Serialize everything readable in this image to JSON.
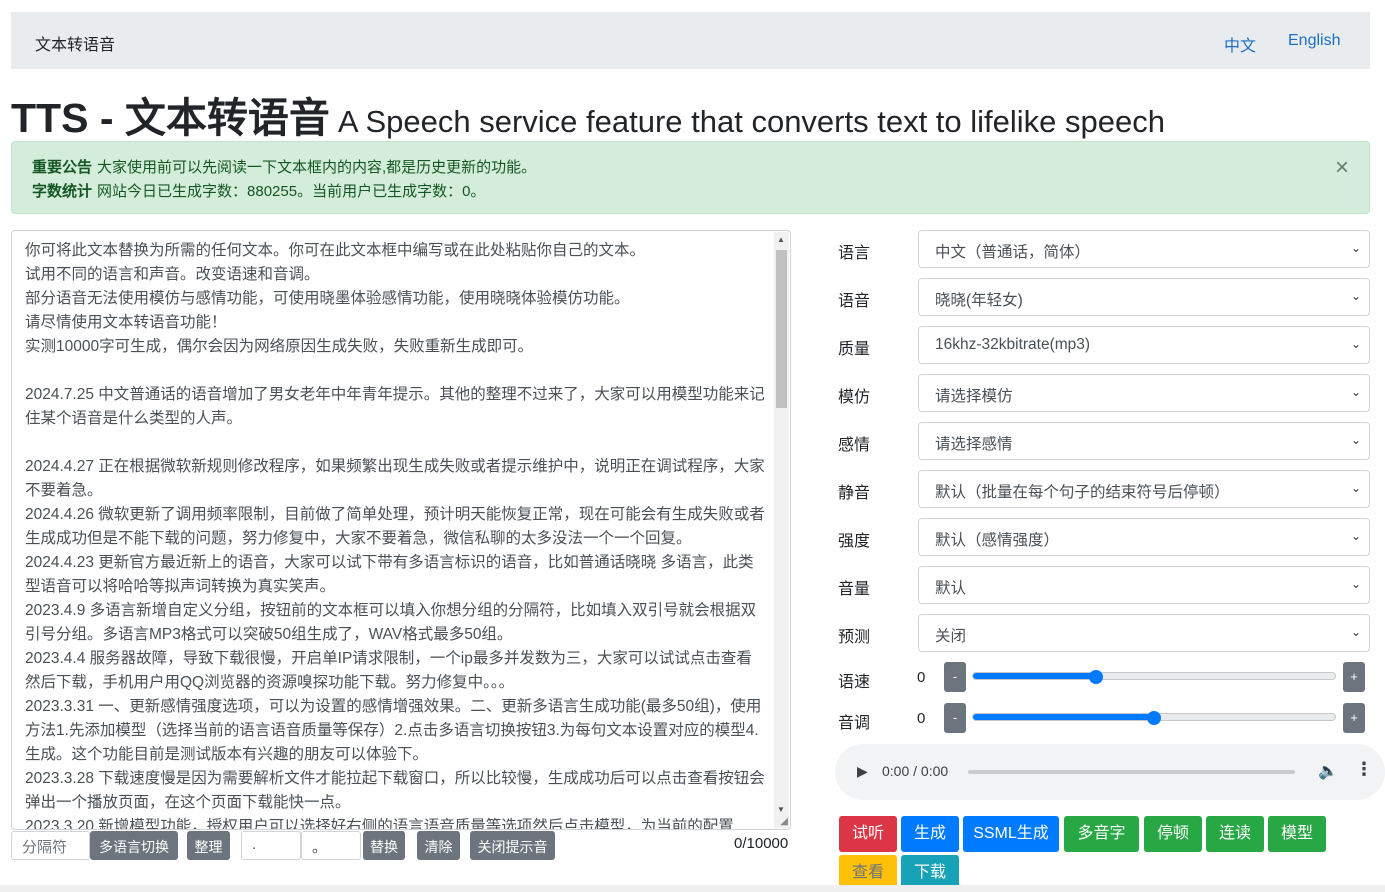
{
  "navbar": {
    "brand": "文本转语音",
    "links": [
      "中文",
      "English"
    ]
  },
  "headline": {
    "big": "TTS - 文本转语音",
    "small": "A Speech service feature that converts text to lifelike speech"
  },
  "alert": {
    "label1": "重要公告",
    "text1": "大家使用前可以先阅读一下文本框内的内容,都是历史更新的功能。",
    "label2": "字数统计",
    "text2": "网站今日已生成字数：880255。当前用户已生成字数：0。",
    "close": "×"
  },
  "textarea": {
    "content": "你可将此文本替换为所需的任何文本。你可在此文本框中编写或在此处粘贴你自己的文本。\n试用不同的语言和声音。改变语速和音调。\n部分语音无法使用模仿与感情功能，可使用晓墨体验感情功能，使用晓晓体验模仿功能。\n请尽情使用文本转语音功能！\n实测10000字可生成，偶尔会因为网络原因生成失败，失败重新生成即可。\n\n2024.7.25 中文普通话的语音增加了男女老年中年青年提示。其他的整理不过来了，大家可以用模型功能来记住某个语音是什么类型的人声。\n\n2024.4.27 正在根据微软新规则修改程序，如果频繁出现生成失败或者提示维护中，说明正在调试程序，大家不要着急。\n2024.4.26 微软更新了调用频率限制，目前做了简单处理，预计明天能恢复正常，现在可能会有生成失败或者生成成功但是不能下载的问题，努力修复中，大家不要着急，微信私聊的太多没法一个一个回复。\n2024.4.23 更新官方最近新上的语音，大家可以试下带有多语言标识的语音，比如普通话晓晓 多语言，此类型语音可以将哈哈等拟声词转换为真实笑声。\n2023.4.9 多语言新增自定义分组，按钮前的文本框可以填入你想分组的分隔符，比如填入双引号就会根据双引号分组。多语言MP3格式可以突破50组生成了，WAV格式最多50组。\n2023.4.4 服务器故障，导致下载很慢，开启单IP请求限制，一个ip最多并发数为三，大家可以试试点击查看然后下载，手机用户用QQ浏览器的资源嗅探功能下载。努力修复中。。。\n2023.3.31 一、更新感情强度选项，可以为设置的感情增强效果。二、更新多语言生成功能(最多50组)，使用方法1.先添加模型（选择当前的语言语音质量等保存）2.点击多语言切换按钮3.为每句文本设置对应的模型4.生成。这个功能目前是测试版本有兴趣的朋友可以体验下。\n2023.3.28 下载速度慢是因为需要解析文件才能拉起下载窗口，所以比较慢，生成成功后可以点击查看按钮会弹出一个播放页面，在这个页面下载能快一点。\n2023.3.20 新增模型功能，授权用户可以选择好右侧的语言语音质量等选项然后点击模型，为当前的配置"
  },
  "bottom_bar": {
    "separator_placeholder": "分隔符",
    "btn_multilang": "多语言切换",
    "btn_tidy": "整理",
    "from_value": ".",
    "to_value": "。",
    "btn_replace": "替换",
    "btn_clear": "清除",
    "btn_close_tip": "关闭提示音",
    "counter": "0/10000"
  },
  "controls": {
    "language": {
      "label": "语言",
      "value": "中文（普通话，简体）"
    },
    "voice": {
      "label": "语音",
      "value": "晓晓(年轻女)"
    },
    "quality": {
      "label": "质量",
      "value": "16khz-32kbitrate(mp3)"
    },
    "imitate": {
      "label": "模仿",
      "value": "请选择模仿"
    },
    "emotion": {
      "label": "感情",
      "value": "请选择感情"
    },
    "silence": {
      "label": "静音",
      "value": "默认（批量在每个句子的结束符号后停顿）"
    },
    "intensity": {
      "label": "强度",
      "value": "默认（感情强度）"
    },
    "volume": {
      "label": "音量",
      "value": "默认"
    },
    "predict": {
      "label": "预测",
      "value": "关闭"
    },
    "rate": {
      "label": "语速",
      "value": "0",
      "level": 0.34
    },
    "pitch": {
      "label": "音调",
      "value": "0",
      "level": 0.5
    },
    "minus": "-",
    "plus": "+"
  },
  "audio": {
    "time": "0:00 / 0:00",
    "play_icon": "play-icon",
    "volume_icon": "volume-icon",
    "more_icon": "more-vert-icon"
  },
  "actions": {
    "listen": "试听",
    "generate": "生成",
    "ssml": "SSML生成",
    "polyphone": "多音字",
    "pause": "停顿",
    "liaison": "连读",
    "model": "模型",
    "view": "查看",
    "download": "下载"
  },
  "colors": {
    "primary": "#007bff",
    "danger": "#dc3545",
    "success": "#28a745",
    "warning": "#ffc107",
    "info": "#17a2b8",
    "secondary": "#6c757d",
    "alert_bg": "#d4edda"
  }
}
